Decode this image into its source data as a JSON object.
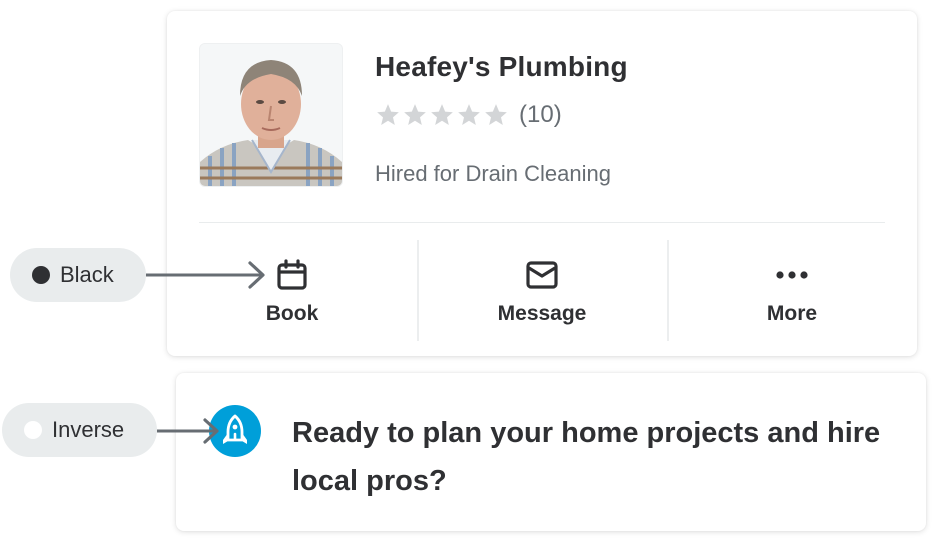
{
  "pro_card": {
    "avatar_alt": "Profile photo of pro",
    "name": "Heafey's Plumbing",
    "rating": {
      "stars_filled": 0,
      "stars_total": 5,
      "review_count": "(10)"
    },
    "hired_for": "Hired for Drain Cleaning",
    "actions": [
      {
        "label": "Book",
        "icon": "calendar-icon"
      },
      {
        "label": "Message",
        "icon": "envelope-icon"
      },
      {
        "label": "More",
        "icon": "more-dots-icon"
      }
    ]
  },
  "promo_card": {
    "icon": "rocket-icon",
    "text": "Ready to plan your home projects and hire local pros?"
  },
  "annotations": [
    {
      "label": "Black",
      "dot_color": "#2f3033",
      "points_to": "calendar-icon"
    },
    {
      "label": "Inverse",
      "dot_color": "#ffffff",
      "points_to": "rocket-icon"
    }
  ],
  "colors": {
    "text_primary": "#2f3033",
    "text_secondary": "#676d73",
    "star_empty": "#d3d5d7",
    "brand_blue": "#009fd9",
    "pill_bg": "#e9eced",
    "arrow": "#676d73"
  }
}
